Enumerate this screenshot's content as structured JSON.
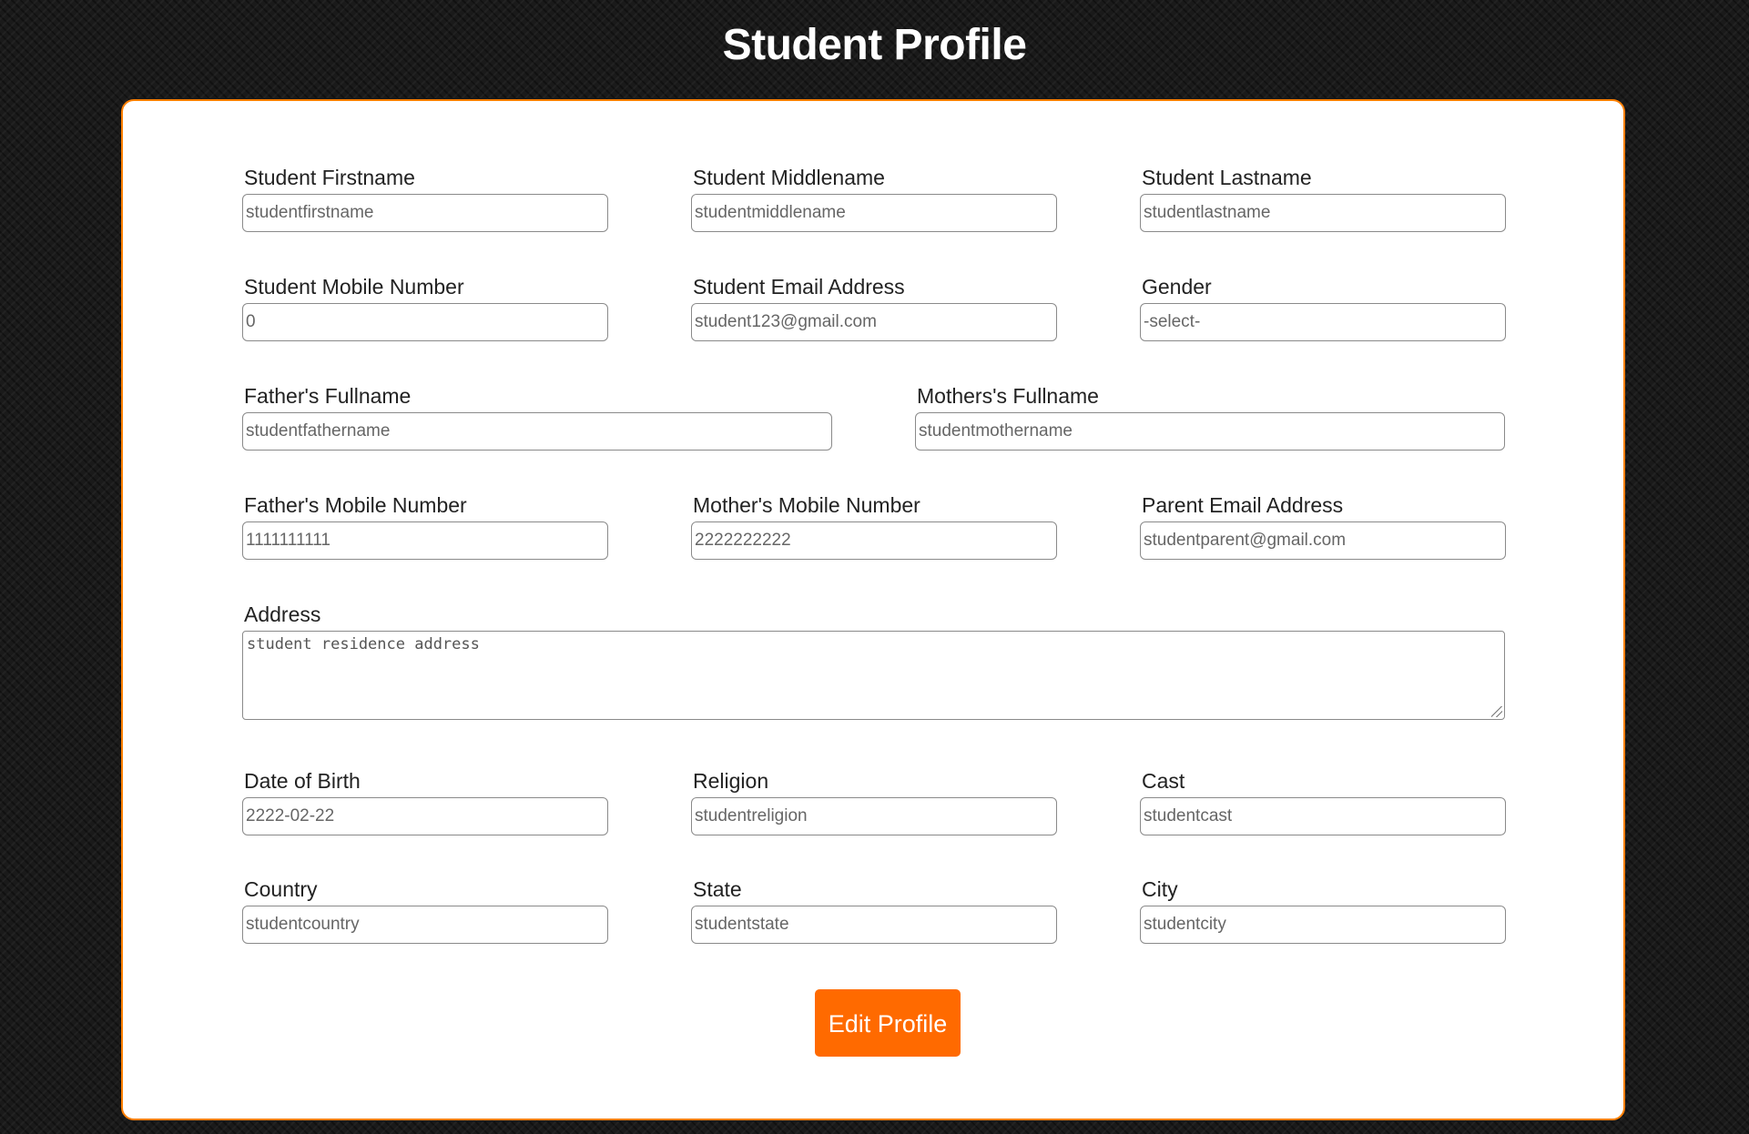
{
  "page": {
    "title": "Student Profile"
  },
  "colors": {
    "background": "#1a1a1a",
    "card_border": "#ff7f00",
    "button": "#ff6a00"
  },
  "fields": {
    "student_firstname": {
      "label": "Student Firstname",
      "value": "studentfirstname"
    },
    "student_middlename": {
      "label": "Student Middlename",
      "value": "studentmiddlename"
    },
    "student_lastname": {
      "label": "Student Lastname",
      "value": "studentlastname"
    },
    "student_mobile": {
      "label": "Student Mobile Number",
      "value": "0"
    },
    "student_email": {
      "label": "Student Email Address",
      "value": "student123@gmail.com"
    },
    "gender": {
      "label": "Gender",
      "value": "-select-"
    },
    "father_fullname": {
      "label": "Father's Fullname",
      "value": "studentfathername"
    },
    "mother_fullname": {
      "label": "Mothers's Fullname",
      "value": "studentmothername"
    },
    "father_mobile": {
      "label": "Father's Mobile Number",
      "value": "1111111111"
    },
    "mother_mobile": {
      "label": "Mother's Mobile Number",
      "value": "2222222222"
    },
    "parent_email": {
      "label": "Parent Email Address",
      "value": "studentparent@gmail.com"
    },
    "address": {
      "label": "Address",
      "value": "student residence address"
    },
    "dob": {
      "label": "Date of Birth",
      "value": "2222-02-22"
    },
    "religion": {
      "label": "Religion",
      "value": "studentreligion"
    },
    "cast": {
      "label": "Cast",
      "value": "studentcast"
    },
    "country": {
      "label": "Country",
      "value": "studentcountry"
    },
    "state": {
      "label": "State",
      "value": "studentstate"
    },
    "city": {
      "label": "City",
      "value": "studentcity"
    }
  },
  "actions": {
    "edit_label": "Edit Profile"
  }
}
